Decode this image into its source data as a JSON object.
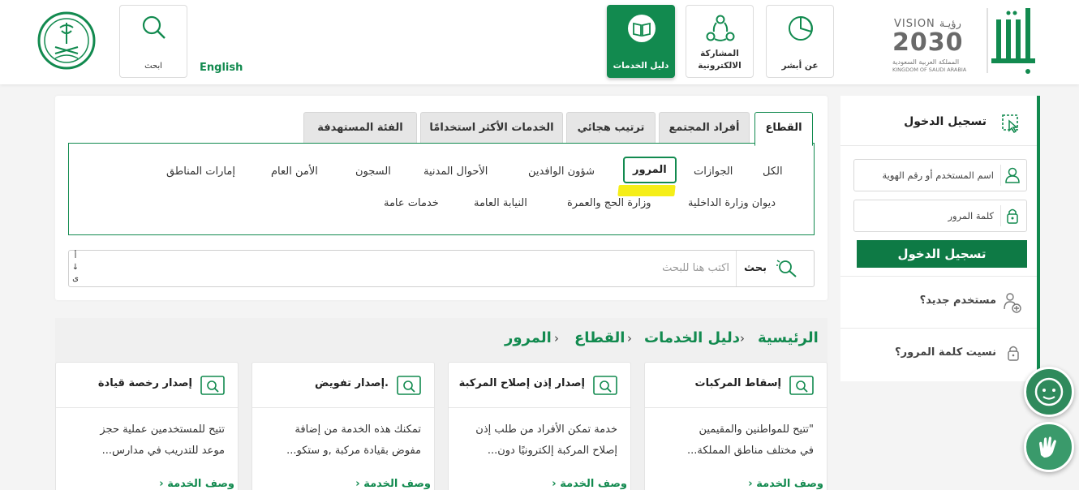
{
  "header": {
    "nav": [
      {
        "label": "عن أبشر",
        "icon": "pie-chart-icon"
      },
      {
        "label": "المشاركة الالكترونية",
        "line1": "المشاركة",
        "line2": "الالكترونية",
        "icon": "network-icon"
      },
      {
        "label": "دليل الخدمات",
        "icon": "book-icon",
        "active": true
      }
    ],
    "search_label": "ابحث",
    "english_label": "English",
    "vision": {
      "line1": "VISION رؤيـة",
      "line2": "2030",
      "line3": "المملكة العربية السعودية",
      "line4": "KINGDOM OF SAUDI ARABIA"
    },
    "absher_logo_text": "أبشر",
    "moi_logo_icon": "ministry-emblem-icon"
  },
  "login": {
    "title": "تسجيل الدخول",
    "username_placeholder": "اسم المستخدم أو رقم الهوية",
    "password_placeholder": "كلمة المرور",
    "submit_label": "تسجيل الدخول",
    "new_user_label": "مستخدم جديد؟",
    "forgot_label": "نسيت كلمة المرور؟"
  },
  "tabs": [
    {
      "label": "القطاع",
      "active": true
    },
    {
      "label": "أفراد المجتمع"
    },
    {
      "label": "ترتيب هجائي"
    },
    {
      "label": "الخدمات الأكثر استخدامًا"
    },
    {
      "label": "الفئة المستهدفة"
    }
  ],
  "sectors": {
    "row1": [
      "الكل",
      "الجوازات",
      "المرور",
      "شؤون الوافدين",
      "الأحوال المدنية",
      "السجون",
      "الأمن العام",
      "إمارات المناطق"
    ],
    "row2": [
      "ديوان وزارة الداخلية",
      "وزارة الحج والعمرة",
      "النيابة العامة",
      "خدمات عامة"
    ],
    "selected": "المرور"
  },
  "search": {
    "button_label": "بحث",
    "placeholder": "اكتب هنا للبحث",
    "hint": [
      "أ",
      "↓",
      "ى"
    ]
  },
  "breadcrumb": [
    "الرئيسية",
    "دليل الخدمات",
    "القطاع",
    "المرور"
  ],
  "services": [
    {
      "title": "إسقاط المركبات",
      "desc_line1": "\"تتيح للمواطنين والمقيمين",
      "desc_line2": "في مختلف مناطق المملكة...",
      "more": "وصف الخدمة"
    },
    {
      "title": "إصدار إذن إصلاح المركبة",
      "desc_line1": "خدمة تمكن الأفراد من طلب إذن",
      "desc_line2": "إصلاح المركبة إلكترونيًا دون...",
      "more": "وصف الخدمة"
    },
    {
      "title": "إصدار تفويض.",
      "desc_line1": "تمكنك هذه الخدمة من إضافة",
      "desc_line2": "مفوض بقيادة مركبة ,و ستكو...",
      "more": "وصف الخدمة"
    },
    {
      "title": "إصدار رخصة قيادة",
      "desc_line1": "تتيح للمستخدمين عملية حجز",
      "desc_line2": "موعد للتدريب في مدارس...",
      "more": "وصف الخدمة"
    }
  ],
  "colors": {
    "accent": "#128a4f",
    "highlight": "#f5ee18"
  },
  "floating": [
    {
      "icon": "chat-assistant-icon"
    },
    {
      "icon": "sign-language-icon"
    }
  ]
}
